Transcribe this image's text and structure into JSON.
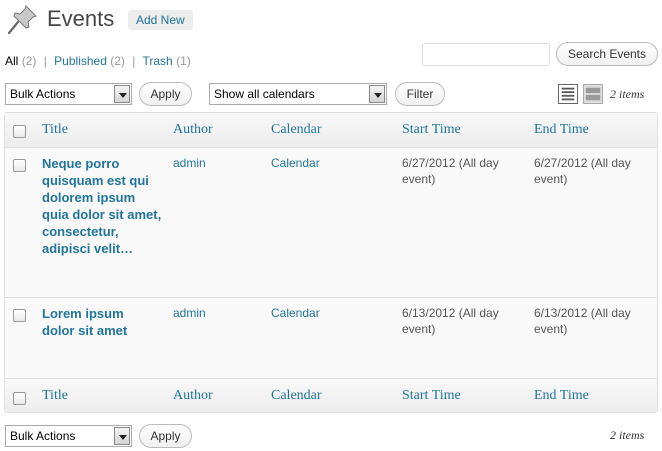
{
  "header": {
    "title": "Events",
    "add_new": "Add New"
  },
  "filters": {
    "all": "All",
    "all_count": "(2)",
    "published": "Published",
    "published_count": "(2)",
    "trash": "Trash",
    "trash_count": "(1)",
    "separator": "|"
  },
  "search": {
    "value": "",
    "button": "Search Events"
  },
  "toolbar": {
    "bulk_actions": "Bulk Actions",
    "apply": "Apply",
    "calendar_filter": "Show all calendars",
    "filter": "Filter",
    "items": "2 items"
  },
  "columns": [
    "Title",
    "Author",
    "Calendar",
    "Start Time",
    "End Time"
  ],
  "rows": [
    {
      "title": "Neque porro quisquam est qui dolorem ipsum quia dolor sit amet, consectetur, adipisci velit…",
      "author": "admin",
      "calendar": "Calendar",
      "start": "6/27/2012 (All day event)",
      "end": "6/27/2012 (All day event)"
    },
    {
      "title": "Lorem ipsum dolor sit amet",
      "author": "admin",
      "calendar": "Calendar",
      "start": "6/13/2012 (All day event)",
      "end": "6/13/2012 (All day event)"
    }
  ],
  "icons": {
    "header": "pushpin-icon",
    "view_list": "list-view-icon",
    "view_excerpt": "excerpt-view-icon"
  },
  "colors": {
    "link": "#21759b",
    "heading": "#464646"
  }
}
